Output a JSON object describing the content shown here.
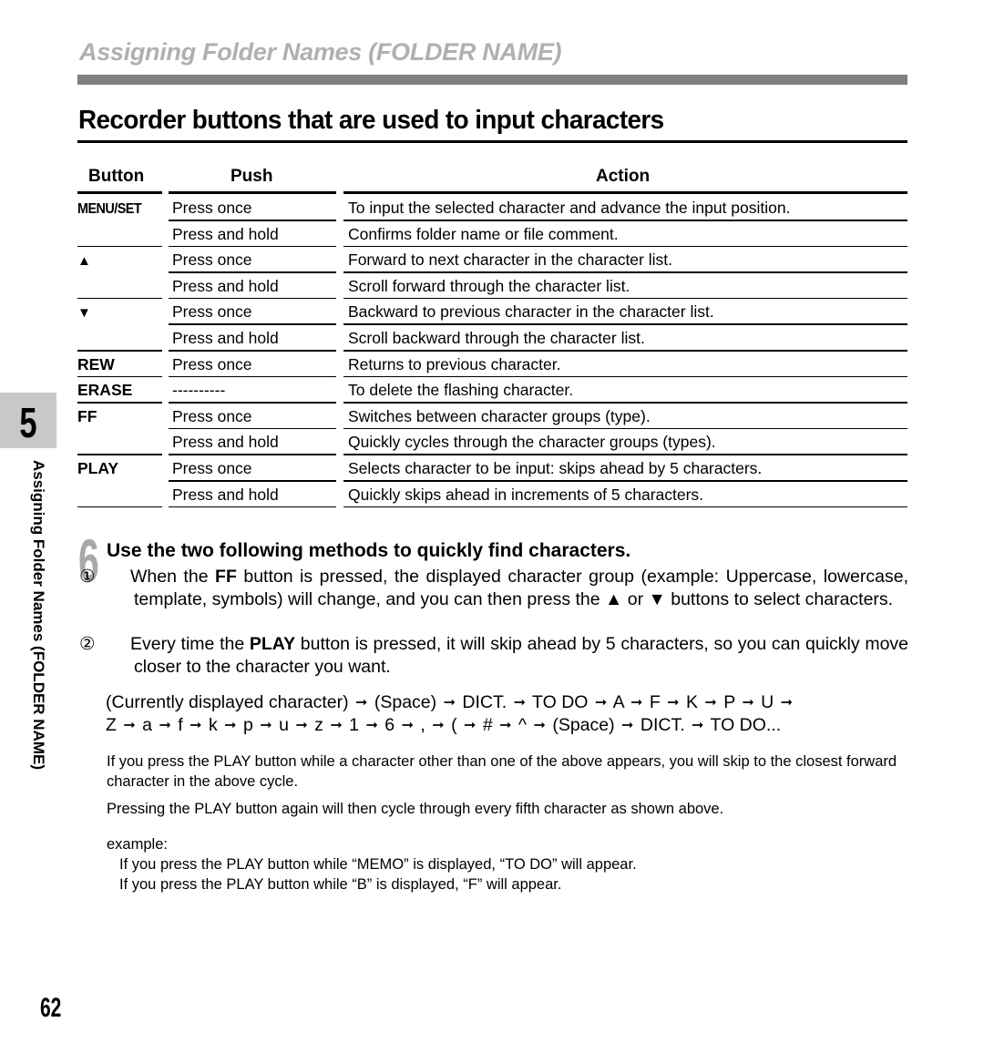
{
  "section_title": "Assigning Folder Names (FOLDER NAME)",
  "heading": "Recorder buttons that are used to input characters",
  "table": {
    "headers": {
      "button": "Button",
      "push": "Push",
      "action": "Action"
    },
    "rows": [
      {
        "button": "MENU/SET",
        "push": "Press once",
        "action": "To input the selected character and advance the input position."
      },
      {
        "button": "",
        "push": "Press and hold",
        "action": "Confirms folder name or file comment."
      },
      {
        "button": "▲",
        "push": "Press once",
        "action": "Forward to next character in the character list."
      },
      {
        "button": "",
        "push": "Press and hold",
        "action": "Scroll forward through the character list."
      },
      {
        "button": "▼",
        "push": "Press once",
        "action": "Backward to previous character in the character list."
      },
      {
        "button": "",
        "push": "Press and hold",
        "action": "Scroll backward through the character list."
      },
      {
        "button": "REW",
        "push": "Press once",
        "action": "Returns to previous character."
      },
      {
        "button": "ERASE",
        "push": "----------",
        "action": "To delete the flashing character."
      },
      {
        "button": "FF",
        "push": "Press once",
        "action": "Switches between character groups (type)."
      },
      {
        "button": "",
        "push": "Press and hold",
        "action": "Quickly cycles through the character groups (types)."
      },
      {
        "button": "PLAY",
        "push": "Press once",
        "action": "Selects character to be input: skips ahead by 5 characters."
      },
      {
        "button": "",
        "push": "Press and hold",
        "action": "Quickly skips ahead in increments of 5 characters."
      }
    ]
  },
  "chapter_tab": {
    "number": "5",
    "label": "Assigning Folder Names (FOLDER NAME)"
  },
  "step": {
    "number": "6",
    "title": "Use the two following methods to quickly find characters.",
    "items": [
      {
        "marker": "①",
        "pre": "When the ",
        "bold": "FF",
        "post": " button is pressed, the displayed character group (example: Uppercase, lowercase, template, symbols) will change, and you can then press the ▲ or ▼ buttons to select characters."
      },
      {
        "marker": "②",
        "pre": "Every time the ",
        "bold": "PLAY",
        "post": " button is pressed, it will skip ahead by 5 characters, so you can quickly move closer to the character you want."
      }
    ]
  },
  "cycle": {
    "line1": [
      "(Currently displayed character)",
      "(Space)",
      "DICT.",
      "TO DO",
      "A",
      "F",
      "K",
      "P",
      "U",
      ""
    ],
    "line2": [
      "Z",
      "a",
      "f",
      "k",
      "p",
      "u",
      "z",
      "1",
      "6",
      ",",
      "(",
      "#",
      "^",
      "(Space)",
      "DICT.",
      "TO DO..."
    ],
    "arrow": "➞"
  },
  "notes": {
    "note1": "If you press the PLAY button while a character other than one of the above appears, you will skip to the closest forward character in the above cycle.",
    "note2": "Pressing the PLAY button again will then cycle through every fifth character as shown above.",
    "example_label": "example:",
    "example1": "If you press the PLAY button while “MEMO” is displayed, “TO DO” will appear.",
    "example2": "If you press the PLAY button while “B” is displayed, “F” will appear."
  },
  "page_number": "62"
}
